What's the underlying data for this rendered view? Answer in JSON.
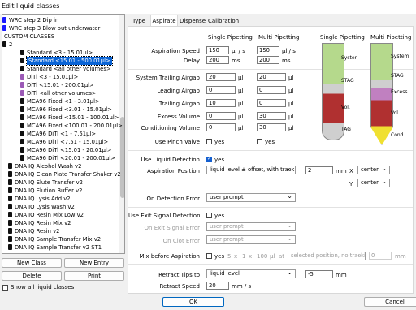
{
  "window": {
    "title": "Edit liquid classes"
  },
  "tree": {
    "items": [
      {
        "text": "WRC step 2 Dip in",
        "indent": 8,
        "icon": "#1a1aff"
      },
      {
        "text": "WRC step 3 Blow out underwater",
        "indent": 8,
        "icon": "#1a1aff"
      },
      {
        "text": "CUSTOM CLASSES",
        "indent": 2,
        "icon": "#111"
      },
      {
        "text": "2",
        "indent": 8,
        "icon": "#111"
      },
      {
        "text": "Standard <3 - 15.01µl>",
        "indent": 30,
        "icon": "#111"
      },
      {
        "text": "Standard <15.01 - 500.01µl>",
        "indent": 30,
        "icon": "#111",
        "selected": true
      },
      {
        "text": "Standard <all other volumes>",
        "indent": 30,
        "icon": "#111"
      },
      {
        "text": "DiTi <3 - 15.01µl>",
        "indent": 30,
        "icon": "#9b59b6"
      },
      {
        "text": "DiTi <15.01 - 200.01µl>",
        "indent": 30,
        "icon": "#9b59b6"
      },
      {
        "text": "DiTi <all other volumes>",
        "indent": 30,
        "icon": "#9b59b6"
      },
      {
        "text": "MCA96 Fixed <1 - 3.01µl>",
        "indent": 30,
        "icon": "#111"
      },
      {
        "text": "MCA96 Fixed <3.01 - 15.01µl>",
        "indent": 30,
        "icon": "#111"
      },
      {
        "text": "MCA96 Fixed <15.01 - 100.01µl>",
        "indent": 30,
        "icon": "#111"
      },
      {
        "text": "MCA96 Fixed <100.01 - 200.01µl>",
        "indent": 30,
        "icon": "#111"
      },
      {
        "text": "MCA96 DiTi <1 - 7.51µl>",
        "indent": 30,
        "icon": "#111"
      },
      {
        "text": "MCA96 DiTi <7.51 - 15.01µl>",
        "indent": 30,
        "icon": "#111"
      },
      {
        "text": "MCA96 DiTi <15.01 - 20.01µl>",
        "indent": 30,
        "icon": "#111"
      },
      {
        "text": "MCA96 DiTi <20.01 - 200.01µl>",
        "indent": 30,
        "icon": "#111"
      },
      {
        "text": "DNA IQ Alcohol Wash v2",
        "indent": 15,
        "icon": "#111"
      },
      {
        "text": "DNA IQ Clean Plate Transfer Shaker v2",
        "indent": 15,
        "icon": "#111"
      },
      {
        "text": "DNA IQ Elute Transfer v2",
        "indent": 15,
        "icon": "#111"
      },
      {
        "text": "DNA IQ Elution Buffer v2",
        "indent": 15,
        "icon": "#111"
      },
      {
        "text": "DNA IQ Lysis Add v2",
        "indent": 15,
        "icon": "#111"
      },
      {
        "text": "DNA IQ Lysis Wash v2",
        "indent": 15,
        "icon": "#111"
      },
      {
        "text": "DNA IQ Resin Mix Low v2",
        "indent": 15,
        "icon": "#111"
      },
      {
        "text": "DNA IQ Resin Mix v2",
        "indent": 15,
        "icon": "#111"
      },
      {
        "text": "DNA IQ Resin v2",
        "indent": 15,
        "icon": "#111"
      },
      {
        "text": "DNA IQ Sample Transfer Mix v2",
        "indent": 15,
        "icon": "#111"
      },
      {
        "text": "DNA IQ Sample Transfer v2 ST1",
        "indent": 15,
        "icon": "#111"
      }
    ]
  },
  "buttons": {
    "new_class": "New Class",
    "new_entry": "New Entry",
    "delete": "Delete",
    "print": "Print",
    "ok": "OK",
    "cancel": "Cancel"
  },
  "show_all": "Show all liquid classes",
  "tabs": [
    "Type",
    "Aspirate",
    "Dispense",
    "Calibration"
  ],
  "aspirate": {
    "col_single": "Single Pipetting",
    "col_multi": "Multi Pipetting",
    "speed_label": "Aspiration Speed",
    "speed_single": "150",
    "speed_multi": "150",
    "speed_unit": "µl / s",
    "delay_label": "Delay",
    "delay_single": "200",
    "delay_multi": "200",
    "delay_unit": "ms",
    "sys_label": "System Trailing Airgap",
    "sys_single": "20",
    "sys_multi": "20",
    "lead_label": "Leading Airgap",
    "lead_single": "0",
    "lead_multi": "0",
    "trail_label": "Trailing Airgap",
    "trail_single": "10",
    "trail_multi": "0",
    "excess_label": "Excess Volume",
    "excess_single": "0",
    "excess_multi": "30",
    "cond_label": "Conditioning Volume",
    "cond_single": "0",
    "cond_multi": "30",
    "pinch_label": "Use Pinch Valve",
    "yes": "yes",
    "ul": "µl",
    "lld_label": "Use Liquid Detection",
    "lld_yes": "yes",
    "pos_label": "Aspiration Position",
    "pos_value": "liquid level ± offset, with tracking",
    "pos_mm": "2",
    "mm": "mm",
    "x_label": "X",
    "x_value": "center",
    "y_label": "Y",
    "y_value": "center",
    "det_err_label": "On Detection Error",
    "det_err_value": "user prompt",
    "exit_label": "Use Exit Signal Detection",
    "exit_err_label": "On Exit Signal Error",
    "exit_err_value": "user prompt",
    "clot_label": "On Clot Error",
    "clot_value": "user prompt",
    "mix_label": "Mix before Aspiration",
    "mix_vol": "5",
    "mix_x": "x",
    "mix_cycles": "1",
    "mix_x2": "x",
    "mix_speed": "100",
    "mix_ul": "µl",
    "mix_at": "at",
    "mix_pos": "selected position, no tracking",
    "mix_mm_val": "0",
    "mix_mm": "mm",
    "retract_label": "Retract Tips to",
    "retract_value": "liquid level",
    "retract_mm": "-5",
    "retract_speed_label": "Retract Speed",
    "retract_speed": "20",
    "retract_speed_unit": "mm / s"
  },
  "diagram": {
    "single_title": "Single Pipetting",
    "multi_title": "Multi Pipetting",
    "single_labels": [
      "Syster",
      "STAG",
      "Vol.",
      "TAG"
    ],
    "multi_labels": [
      "System",
      "STAG",
      "Excess",
      "Vol.",
      "Cond."
    ]
  }
}
